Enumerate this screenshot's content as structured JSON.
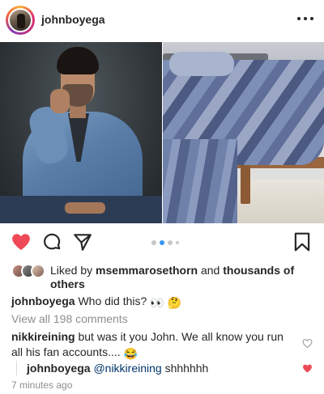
{
  "post": {
    "username": "johnboyega"
  },
  "carousel": {
    "total": 5,
    "active_index": 1
  },
  "likes": {
    "prefix": "Liked by",
    "first_user": "msemmarosethorn",
    "conjunction": "and",
    "rest": "thousands of others"
  },
  "caption": {
    "username": "johnboyega",
    "text": "Who did this?",
    "emojis": "👀 🤔"
  },
  "view_all_comments": "View all 198 comments",
  "comments": [
    {
      "username": "nikkireining",
      "text": "but was it you John. We all know you run all his fan accounts....",
      "emoji": "😂",
      "liked": false
    },
    {
      "username": "johnboyega",
      "mention": "@nikkireining",
      "text": "shhhhhh",
      "liked": true
    }
  ],
  "timestamp": "7 minutes ago",
  "colors": {
    "like_red": "#ed4956",
    "link_blue": "#3897f0",
    "muted_gray": "#8e8e8e",
    "text_dark": "#262626"
  },
  "icons": {
    "heart": "heart-filled-icon",
    "comment": "comment-icon",
    "share": "paper-plane-icon",
    "bookmark": "bookmark-icon",
    "more": "more-horizontal-icon"
  }
}
